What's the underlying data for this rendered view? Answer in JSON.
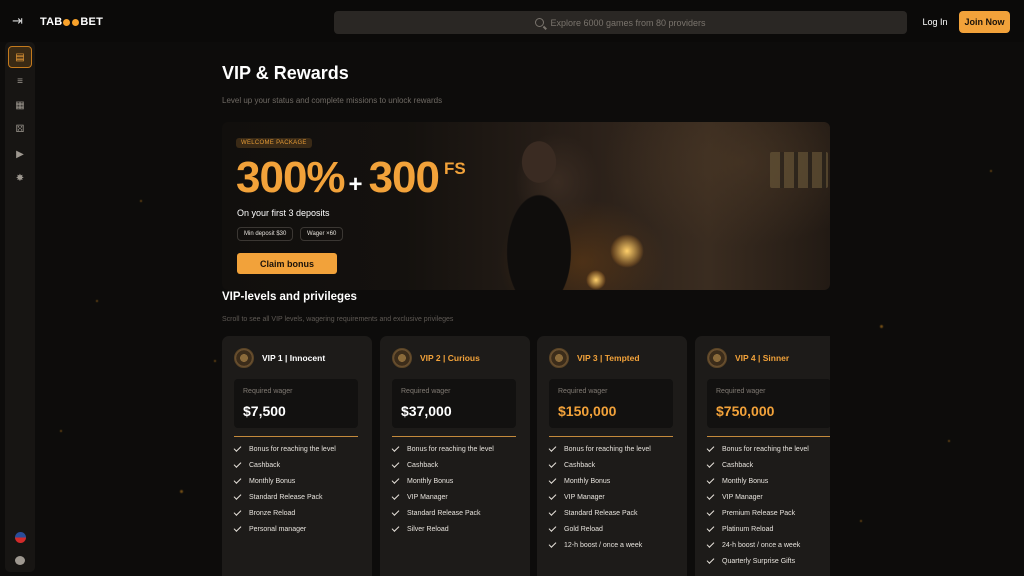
{
  "header": {
    "logo_text_left": "TAB",
    "logo_text_right": "BET",
    "search_placeholder": "Explore 6000 games from 80 providers",
    "login_label": "Log In",
    "join_label": "Join Now"
  },
  "sidebar": {
    "items": [
      "gift-icon",
      "promotions-icon",
      "casino-icon",
      "dice-icon",
      "live-icon",
      "sports-icon"
    ],
    "bottom": [
      "flag-icon",
      "chat-icon"
    ]
  },
  "page": {
    "title": "VIP & Rewards",
    "subtitle": "Level up your status and complete missions to unlock rewards"
  },
  "hero": {
    "badge": "WELCOME PACKAGE",
    "percent": "300%",
    "plus": "+",
    "fs_amount": "300",
    "fs_label": "FS",
    "description": "On your first 3 deposits",
    "chips": [
      "Min deposit $30",
      "Wager ×60"
    ],
    "cta": "Claim bonus"
  },
  "vip_section": {
    "title": "VIP-levels and privileges",
    "subtitle": "Scroll to see all VIP levels, wagering requirements and exclusive privileges",
    "wager_label": "Required wager",
    "cards": [
      {
        "title": "VIP 1 | Innocent",
        "wager": "$7,500",
        "perks": [
          "Bonus for reaching the level",
          "Cashback",
          "Monthly Bonus",
          "Standard Release Pack",
          "Bronze Reload",
          "Personal manager"
        ]
      },
      {
        "title": "VIP 2 | Curious",
        "wager": "$37,000",
        "perks": [
          "Bonus for reaching the level",
          "Cashback",
          "Monthly Bonus",
          "VIP Manager",
          "Standard Release Pack",
          "Silver Reload"
        ]
      },
      {
        "title": "VIP 3 | Tempted",
        "wager": "$150,000",
        "perks": [
          "Bonus for reaching the level",
          "Cashback",
          "Monthly Bonus",
          "VIP Manager",
          "Standard Release Pack",
          "Gold Reload",
          "12-h boost / once a week"
        ]
      },
      {
        "title": "VIP 4 | Sinner",
        "wager": "$750,000",
        "perks": [
          "Bonus for reaching the level",
          "Cashback",
          "Monthly Bonus",
          "VIP Manager",
          "Premium Release Pack",
          "Platinum Reload",
          "24-h boost / once a week",
          "Quarterly Surprise Gifts"
        ]
      }
    ]
  },
  "colors": {
    "accent": "#f2a23a",
    "background": "#0d0c0b",
    "card": "#1d1b19"
  }
}
